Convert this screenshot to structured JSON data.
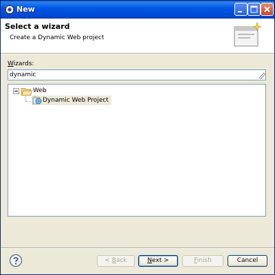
{
  "window": {
    "title": "New",
    "controls": [
      "minimize-icon",
      "maximize-icon",
      "close-icon"
    ]
  },
  "banner": {
    "title": "Select a wizard",
    "description": "Create a Dynamic Web project"
  },
  "wizards": {
    "label_prefix": "",
    "label_mnemonic": "W",
    "label_rest": "izards:",
    "filter_value": "dynamic"
  },
  "tree": {
    "category": "Web",
    "items": [
      {
        "label": "Dynamic Web Project",
        "selected": true
      }
    ]
  },
  "buttons": {
    "back_prefix": "< ",
    "back_mnemonic": "B",
    "back_rest": "ack",
    "next_mnemonic": "N",
    "next_rest": "ext >",
    "finish_mnemonic": "F",
    "finish_rest": "inish",
    "cancel": "Cancel"
  },
  "colors": {
    "titlebar": "#0058e6",
    "dialog_bg": "#ece9d8",
    "selection": "#ece9d8"
  }
}
